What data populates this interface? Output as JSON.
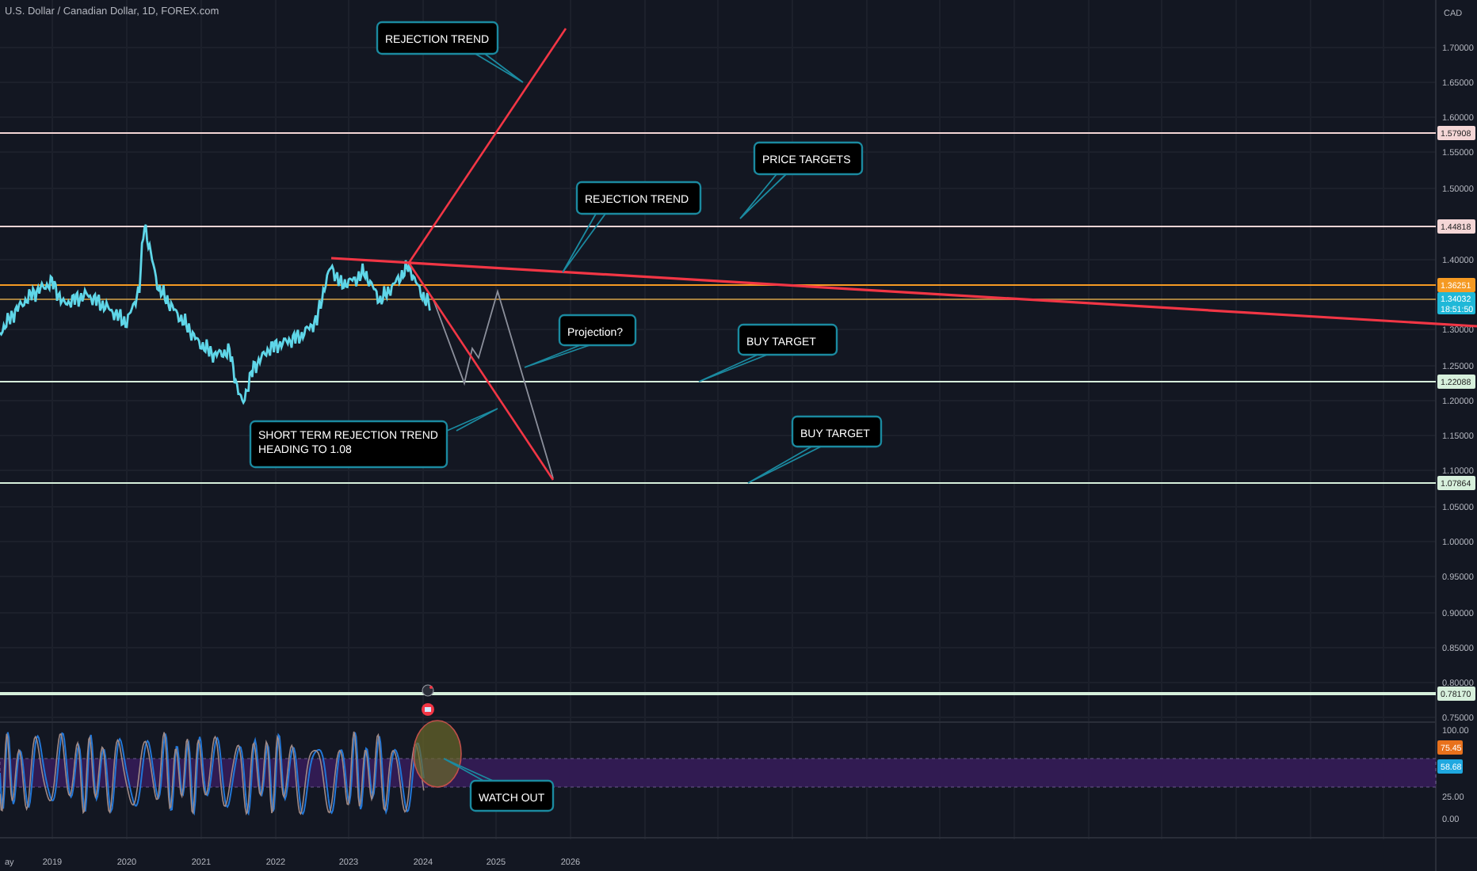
{
  "header": {
    "symbol": "U.S. Dollar / Canadian Dollar, 1D, FOREX.com"
  },
  "price_axis": {
    "currency": "CAD",
    "ticks": [
      "1.70000",
      "1.65000",
      "1.60000",
      "1.55000",
      "1.50000",
      "1.40000",
      "1.30000",
      "1.25000",
      "1.20000",
      "1.15000",
      "1.10000",
      "1.05000",
      "1.00000",
      "0.95000",
      "0.90000",
      "0.85000",
      "0.80000",
      "0.75000"
    ]
  },
  "levels": [
    {
      "price": "1.57908",
      "color": "#f4d6d6"
    },
    {
      "price": "1.44818",
      "color": "#f4d6d6"
    },
    {
      "price": "1.36251",
      "color": "#f59a23"
    },
    {
      "price": "1.22088",
      "color": "#d7f0dc"
    },
    {
      "price": "1.07864",
      "color": "#d7f0dc"
    },
    {
      "price": "0.78170",
      "color": "#d7f0dc"
    }
  ],
  "last_price": {
    "price": "1.34032",
    "countdown": "18:51:50"
  },
  "callouts": [
    {
      "lines": [
        "REJECTION TREND"
      ]
    },
    {
      "lines": [
        "PRICE TARGETS"
      ]
    },
    {
      "lines": [
        "REJECTION TREND"
      ]
    },
    {
      "lines": [
        "Projection?"
      ]
    },
    {
      "lines": [
        "BUY TARGET"
      ]
    },
    {
      "lines": [
        "SHORT TERM REJECTION TREND",
        "HEADING TO 1.08"
      ]
    },
    {
      "lines": [
        "BUY TARGET"
      ]
    },
    {
      "lines": [
        "WATCH OUT"
      ]
    }
  ],
  "oscillator": {
    "ticks": [
      "100.00",
      "25.00",
      "0.00"
    ],
    "values": [
      {
        "value": "75.45",
        "color": "#e8711c"
      },
      {
        "value": "58.68",
        "color": "#1fa8e0"
      }
    ]
  },
  "time_axis": [
    "ay",
    "2019",
    "2020",
    "2021",
    "2022",
    "2023",
    "2024",
    "2025",
    "2026"
  ]
}
